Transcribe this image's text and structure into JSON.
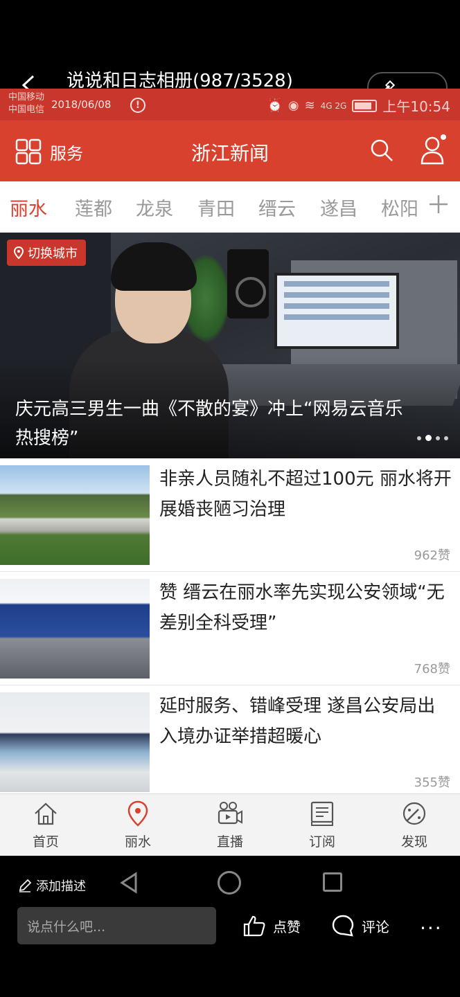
{
  "viewer": {
    "album_title": "说说和日志相册(987/3528)",
    "add_desc": "添加描述",
    "comment_placeholder": "说点什么吧...",
    "like_label": "点赞",
    "comment_label": "评论",
    "more_label": "···"
  },
  "statusbar": {
    "carrier1": "中国移动",
    "carrier2": "中国电信",
    "date": "2018/06/08",
    "warn": "!",
    "network": "4G 2G",
    "time": "上午10:54"
  },
  "appbar": {
    "service_label": "服务",
    "title": "浙江新闻"
  },
  "city_tabs": [
    "丽水",
    "莲都",
    "龙泉",
    "青田",
    "缙云",
    "遂昌",
    "松阳"
  ],
  "hero": {
    "switch_city": "切换城市",
    "title": "庆元高三男生一曲《不散的宴》冲上“网易云音乐热搜榜”"
  },
  "news": [
    {
      "title": "非亲人员随礼不超过100元 丽水将开展婚丧陋习治理",
      "likes": "962赞"
    },
    {
      "title": "赞 缙云在丽水率先实现公安领域“无差别全科受理”",
      "likes": "768赞"
    },
    {
      "title": "延时服务、错峰受理 遂昌公安局出入境办证举措超暖心",
      "likes": "355赞"
    }
  ],
  "bottom_nav": [
    {
      "label": "首页",
      "icon": "home-icon"
    },
    {
      "label": "丽水",
      "icon": "location-pin-icon"
    },
    {
      "label": "直播",
      "icon": "video-camera-icon"
    },
    {
      "label": "订阅",
      "icon": "subscribe-icon"
    },
    {
      "label": "发现",
      "icon": "discover-icon"
    }
  ],
  "colors": {
    "brand_red": "#d9412f",
    "status_red": "#c9362c"
  }
}
